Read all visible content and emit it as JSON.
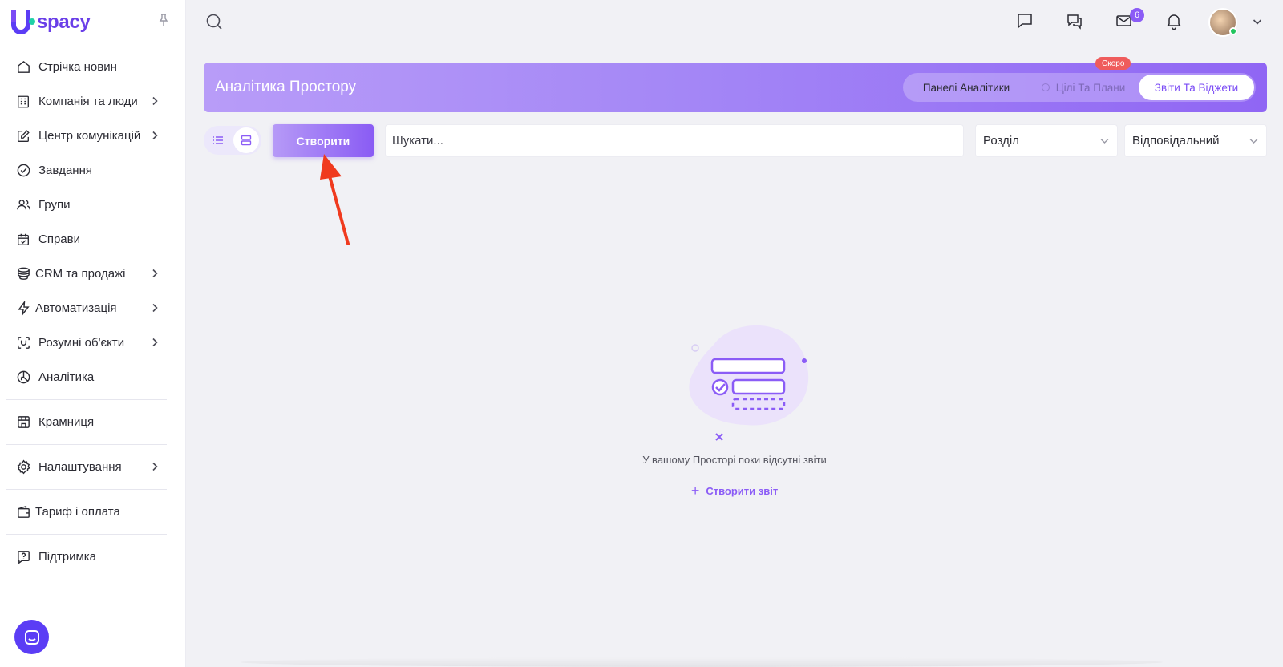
{
  "logo": {
    "text": "spacy"
  },
  "sidebar": {
    "items": [
      {
        "label": "Стрічка новин",
        "icon": "home-icon",
        "chevron": false
      },
      {
        "label": "Компанія та люди",
        "icon": "building-icon",
        "chevron": true
      },
      {
        "label": "Центр комунікацій",
        "icon": "edit-icon",
        "chevron": true
      },
      {
        "label": "Завдання",
        "icon": "check-circle-icon",
        "chevron": false
      },
      {
        "label": "Групи",
        "icon": "users-icon",
        "chevron": false
      },
      {
        "label": "Справи",
        "icon": "calendar-check-icon",
        "chevron": false
      },
      {
        "label": "CRM та продажі",
        "icon": "coins-icon",
        "chevron": true
      },
      {
        "label": "Автоматизація",
        "icon": "lightning-icon",
        "chevron": true
      },
      {
        "label": "Розумні об'єкти",
        "icon": "scan-icon",
        "chevron": true
      },
      {
        "label": "Аналітика",
        "icon": "pie-chart-icon",
        "chevron": false
      }
    ],
    "store": "Крамниця",
    "settings": "Налаштування",
    "billing": "Тариф і оплата",
    "support": "Підтримка"
  },
  "topbar": {
    "mail_count": "6"
  },
  "banner": {
    "title": "Аналітика Простору",
    "tabs": {
      "dashboards": "Панелі Аналітики",
      "goals": "Цілі Та Плани",
      "reports": "Звіти Та Віджети"
    },
    "soon_badge": "Скоро"
  },
  "toolbar": {
    "create_label": "Створити",
    "search_placeholder": "Шукати...",
    "section_select": "Розділ",
    "responsible_select": "Відповідальний"
  },
  "empty": {
    "message": "У вашому Просторі поки відсутні звіти",
    "create_report": "Створити звіт"
  },
  "colors": {
    "accent": "#8b5cf6",
    "brand": "#5b3df5",
    "soon": "#ef5c5c",
    "arrow": "#f03a1e"
  }
}
